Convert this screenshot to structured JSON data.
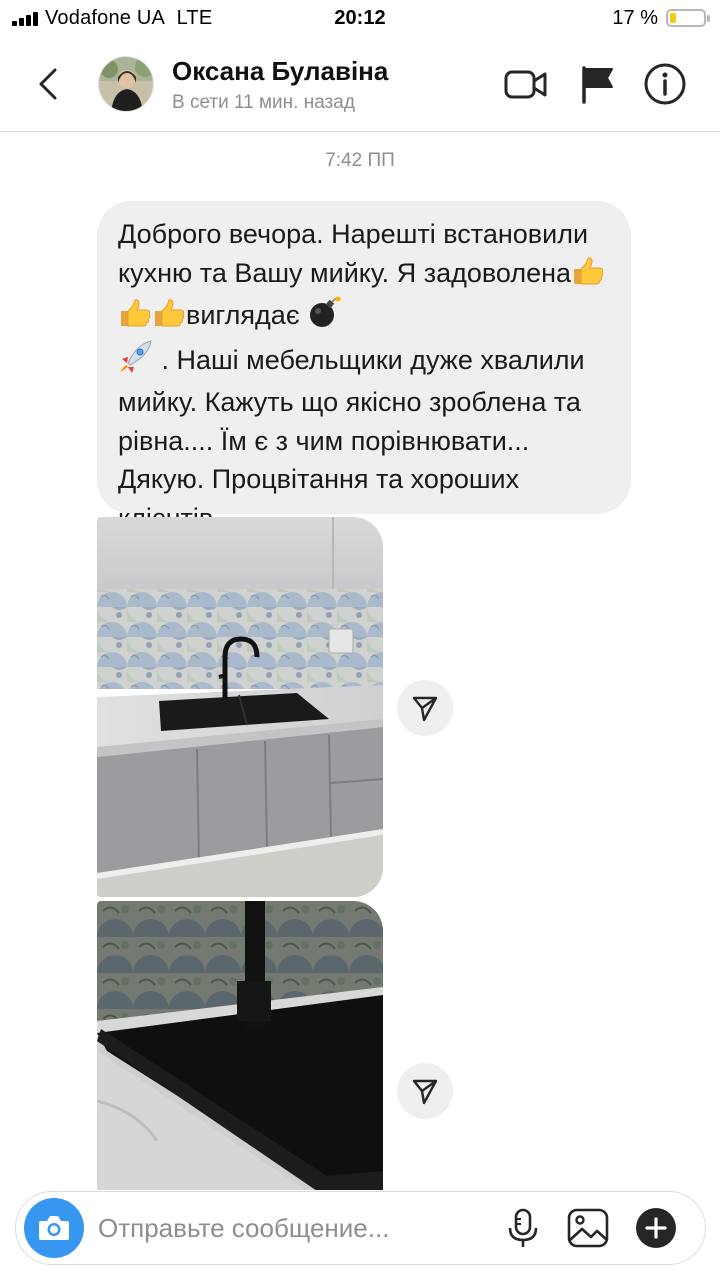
{
  "status_bar": {
    "carrier": "Vodafone UA",
    "network": "LTE",
    "time": "20:12",
    "battery_percent": "17 %",
    "battery_color": "#f5c90f"
  },
  "header": {
    "back_icon": "chevron-left-icon",
    "contact_name": "Оксана Булавіна",
    "contact_status": "В сети 11 мин. назад",
    "icons": [
      "video-call-icon",
      "flag-icon",
      "info-icon"
    ]
  },
  "chat": {
    "timestamp": "7:42 ПП",
    "message": {
      "part1": "Доброго вечора. Нарешті встановили кухню та Вашу мийку. Я задоволена",
      "part2": "виглядає ",
      "part3": " . Наші мебельщики дуже хвалили мийку. Кажуть що якісно зроблена та рівна.... Їм є з чим порівнювати... Дякую. Процвітання та хороших клієнтів",
      "emojis": [
        "thumbs-up-icon",
        "thumbs-up-icon",
        "thumbs-up-icon",
        "bomb-icon",
        "rocket-icon"
      ]
    },
    "photos": [
      {
        "name": "kitchen-sink-photo-1",
        "share_icon": "send-icon"
      },
      {
        "name": "kitchen-sink-photo-2",
        "share_icon": "send-icon"
      }
    ],
    "accent_color": "#3797f0"
  },
  "composer": {
    "placeholder": "Отправьте сообщение...",
    "icons": [
      "camera-icon",
      "microphone-icon",
      "gallery-icon",
      "plus-icon"
    ]
  }
}
